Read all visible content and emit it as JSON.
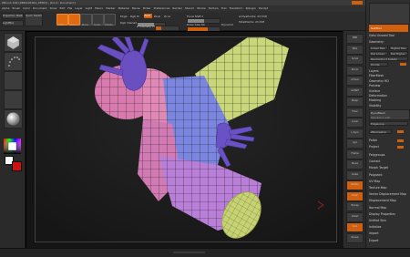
{
  "window": {
    "title": "ZBrush 4R4 [ZBRUSH4R4_DEMO] - [Doc1: Document]"
  },
  "menu": {
    "items": [
      "Alpha",
      "Brush",
      "Color",
      "Document",
      "Draw",
      "Edit",
      "File",
      "Layer",
      "Light",
      "Macro",
      "Marker",
      "Material",
      "Movie",
      "Picker",
      "Preferences",
      "Render",
      "Stencil",
      "Stroke",
      "Texture",
      "Tool",
      "Transform",
      "Zplugin",
      "Zscript"
    ]
  },
  "toolbar": {
    "projection_master": "Projection Master",
    "lightbox": "LightBox",
    "quick_sketch": "Quick Sketch",
    "buttons": [
      "Edit",
      "Draw",
      "Move",
      "Scale",
      "Rotate"
    ],
    "mrgb": "Mrgb",
    "rgb": "Rgb",
    "m": "M",
    "zadd": "Zadd",
    "zsub": "Zsub",
    "zcut": "Zcut",
    "rgb_intensity": "Rgb Intensity",
    "z_intensity": "Z Intensity 25",
    "focal_shift": "Focal Shift 0",
    "draw_size": "Draw Size 64",
    "dynamic": "Dynamic",
    "active_points": "ActivePoints: 23,538",
    "total_points": "TotalPoints: 23,538"
  },
  "right_panel": {
    "top_items": [
      "Goto Unused Tool",
      "SubTool",
      "Geometry",
      "Layers",
      "FiberMesh",
      "Geometry HD",
      "Preview",
      "Surface",
      "Deformation",
      "Masking",
      "Visibility",
      "Polygroups",
      "Contact",
      "Morph Target",
      "Polypaint",
      "UV Map",
      "Texture Map",
      "Vector Displacement Map",
      "Displacement Map",
      "Normal Map",
      "Display Properties",
      "Unified Skin",
      "Initialize",
      "Import",
      "Export"
    ],
    "subdivision": "SDiv 1",
    "buttons": [
      "Lower Res",
      "Higher Res",
      "Del Lower",
      "Del Higher",
      "Reconstruct Subdiv",
      "Divide",
      "Smt",
      "Suv",
      "ReUV"
    ],
    "dynamesh": "DynaMesh",
    "resolution": "Resolution 128",
    "polish": "Polish",
    "project": "Project",
    "edgeloop": "EdgeLoop",
    "zremesher": "ZRemesher"
  },
  "left_tray": {
    "colors": {
      "main": "#ffffff",
      "secondary": "#cc1111",
      "accent": "#e06a10"
    }
  },
  "right_shelf": {
    "labels": [
      "BPR",
      "SPix",
      "Scroll",
      "Zoom",
      "Actual",
      "AAHalf",
      "Persp",
      "Floor",
      "Local",
      "L.Sym",
      "Xyz",
      "Frame",
      "Move",
      "Scale",
      "Rotate",
      "PolyF",
      "Transp",
      "Ghost",
      "Solo",
      "Xpose"
    ]
  }
}
